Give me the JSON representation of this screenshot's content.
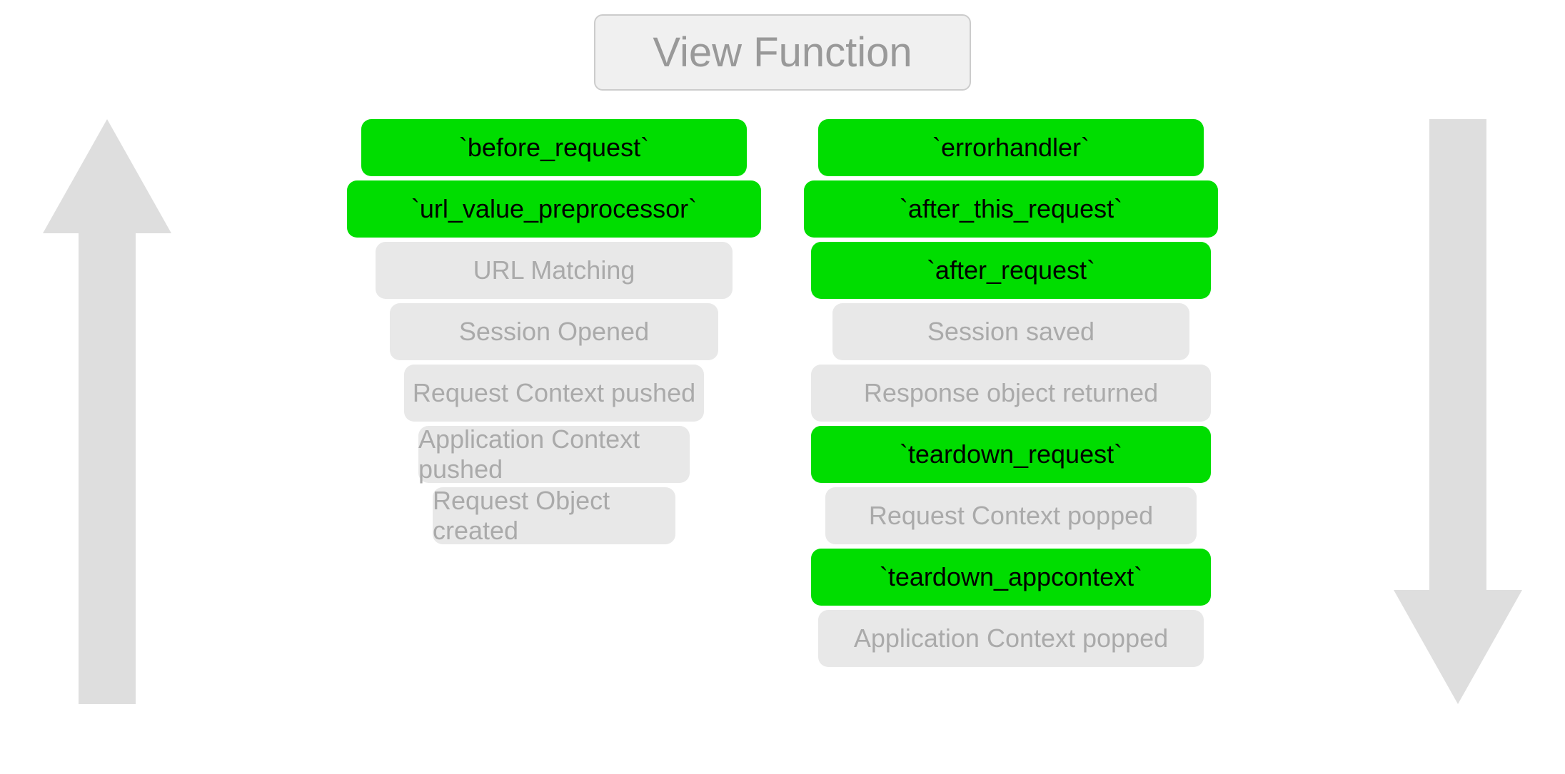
{
  "header": {
    "view_function_label": "View Function"
  },
  "left_pyramid": {
    "items": [
      {
        "id": "before-request",
        "label": "`before_request`",
        "type": "green",
        "row": 1
      },
      {
        "id": "url-value-preprocessor",
        "label": "`url_value_preprocessor`",
        "type": "green",
        "row": 2
      },
      {
        "id": "url-matching",
        "label": "URL Matching",
        "type": "gray",
        "row": 3
      },
      {
        "id": "session-opened",
        "label": "Session Opened",
        "type": "gray",
        "row": 4
      },
      {
        "id": "request-context-pushed",
        "label": "Request Context pushed",
        "type": "gray",
        "row": 5
      },
      {
        "id": "application-context-pushed",
        "label": "Application Context pushed",
        "type": "gray",
        "row": 6
      },
      {
        "id": "request-object-created",
        "label": "Request Object created",
        "type": "gray",
        "row": 7
      }
    ]
  },
  "right_pyramid": {
    "items": [
      {
        "id": "errorhandler",
        "label": "`errorhandler`",
        "type": "green",
        "row": 1
      },
      {
        "id": "after-this-request",
        "label": "`after_this_request`",
        "type": "green",
        "row": 2
      },
      {
        "id": "after-request",
        "label": "`after_request`",
        "type": "green",
        "row": 3
      },
      {
        "id": "session-saved",
        "label": "Session saved",
        "type": "gray",
        "row": 4
      },
      {
        "id": "response-object-returned",
        "label": "Response object returned",
        "type": "gray",
        "row": 5
      },
      {
        "id": "teardown-request",
        "label": "`teardown_request`",
        "type": "green",
        "row": 6
      },
      {
        "id": "request-context-popped",
        "label": "Request Context popped",
        "type": "gray",
        "row": 7
      },
      {
        "id": "teardown-appcontext",
        "label": "`teardown_appcontext`",
        "type": "green",
        "row": 8
      },
      {
        "id": "application-context-popped",
        "label": "Application Context popped",
        "type": "gray",
        "row": 9
      }
    ]
  },
  "arrows": {
    "left_label": "up arrow",
    "right_label": "down arrow"
  }
}
